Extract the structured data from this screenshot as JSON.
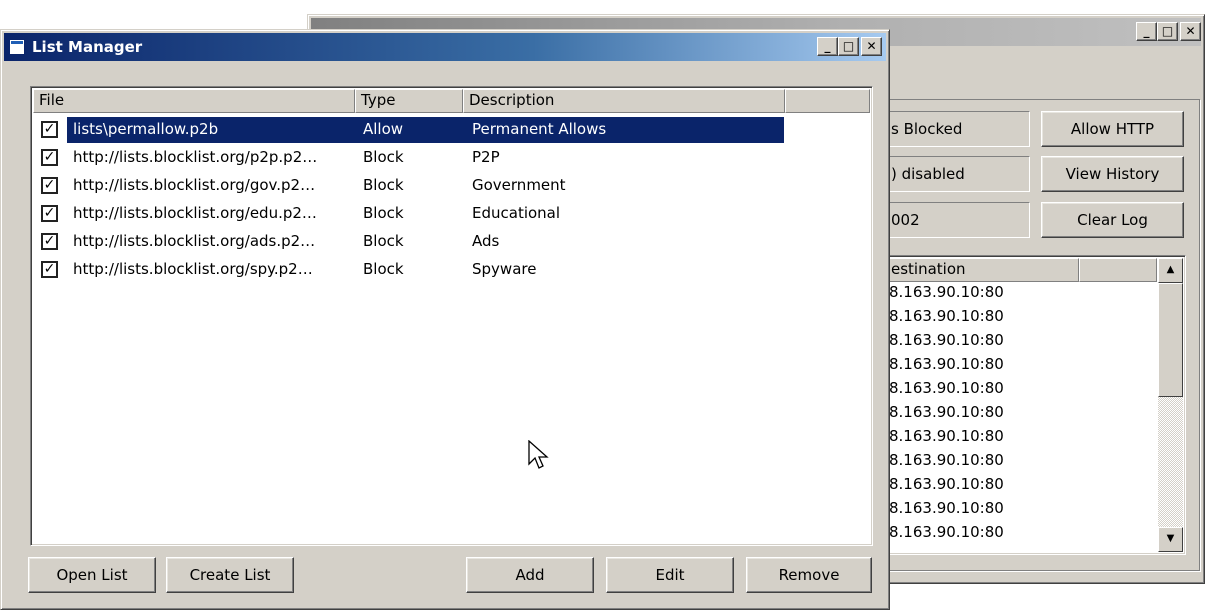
{
  "background_window": {
    "title": "",
    "buttons": {
      "allow_http": "Allow HTTP",
      "view_history": "View History",
      "clear_log": "Clear Log"
    },
    "fields": [
      "s Blocked",
      ") disabled",
      "002"
    ],
    "log_header": "estination",
    "log_rows": [
      "8.163.90.10:80",
      "8.163.90.10:80",
      "8.163.90.10:80",
      "8.163.90.10:80",
      "8.163.90.10:80",
      "8.163.90.10:80",
      "8.163.90.10:80",
      "8.163.90.10:80",
      "8.163.90.10:80",
      "8.163.90.10:80",
      "8.163.90.10:80"
    ],
    "scroll_up": "▲",
    "scroll_down": "▼"
  },
  "list_manager": {
    "title": "List Manager",
    "caption": {
      "minimize": "_",
      "maximize": "□",
      "close": "✕"
    },
    "columns": {
      "file": "File",
      "type": "Type",
      "description": "Description"
    },
    "rows": [
      {
        "file": "lists\\permallow.p2b",
        "type": "Allow",
        "description": "Permanent Allows",
        "checked": true,
        "selected": true
      },
      {
        "file": "http://lists.blocklist.org/p2p.p2…",
        "type": "Block",
        "description": "P2P",
        "checked": true,
        "selected": false
      },
      {
        "file": "http://lists.blocklist.org/gov.p2…",
        "type": "Block",
        "description": "Government",
        "checked": true,
        "selected": false
      },
      {
        "file": "http://lists.blocklist.org/edu.p2…",
        "type": "Block",
        "description": "Educational",
        "checked": true,
        "selected": false
      },
      {
        "file": "http://lists.blocklist.org/ads.p2…",
        "type": "Block",
        "description": "Ads",
        "checked": true,
        "selected": false
      },
      {
        "file": "http://lists.blocklist.org/spy.p2…",
        "type": "Block",
        "description": "Spyware",
        "checked": true,
        "selected": false
      }
    ],
    "check_mark": "✓",
    "buttons": {
      "open_list": "Open List",
      "create_list": "Create List",
      "add": "Add",
      "edit": "Edit",
      "remove": "Remove"
    }
  },
  "colors": {
    "window_face": "#d4d0c8",
    "selection": "#0a246a",
    "title_active": "#0a246a"
  },
  "icons": [
    "window-icon",
    "mouse-cursor-icon",
    "checkbox-checked-icon"
  ]
}
